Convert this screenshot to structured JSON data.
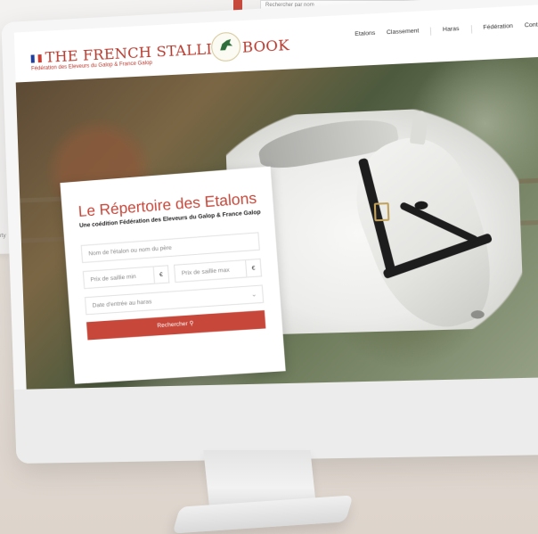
{
  "background_page": {
    "search_placeholder": "Rechercher par nom",
    "side_text": "rty"
  },
  "site": {
    "title": "THE FRENCH STALLION BOOK",
    "subtitle": "Fédération des Eleveurs du Galop & France Galop",
    "logo": "federation-horse-seal"
  },
  "nav": {
    "items": [
      "Etalons",
      "Classement",
      "Haras",
      "Fédération",
      "Contact"
    ]
  },
  "search": {
    "title": "Le Répertoire des Etalons",
    "subtitle": "Une coédition Fédération des Eleveurs du Galop & France Galop",
    "name_placeholder": "Nom de l'étalon ou nom du père",
    "min_price_placeholder": "Prix de saillie min",
    "max_price_placeholder": "Prix de saillie max",
    "currency": "€",
    "date_placeholder": "Date d'entrée au haras",
    "button_label": "Rechercher",
    "button_icon": "search-icon"
  },
  "colors": {
    "brand_red": "#c7473a",
    "flag_blue": "#1f3fa0",
    "flag_red": "#d23a2f"
  }
}
